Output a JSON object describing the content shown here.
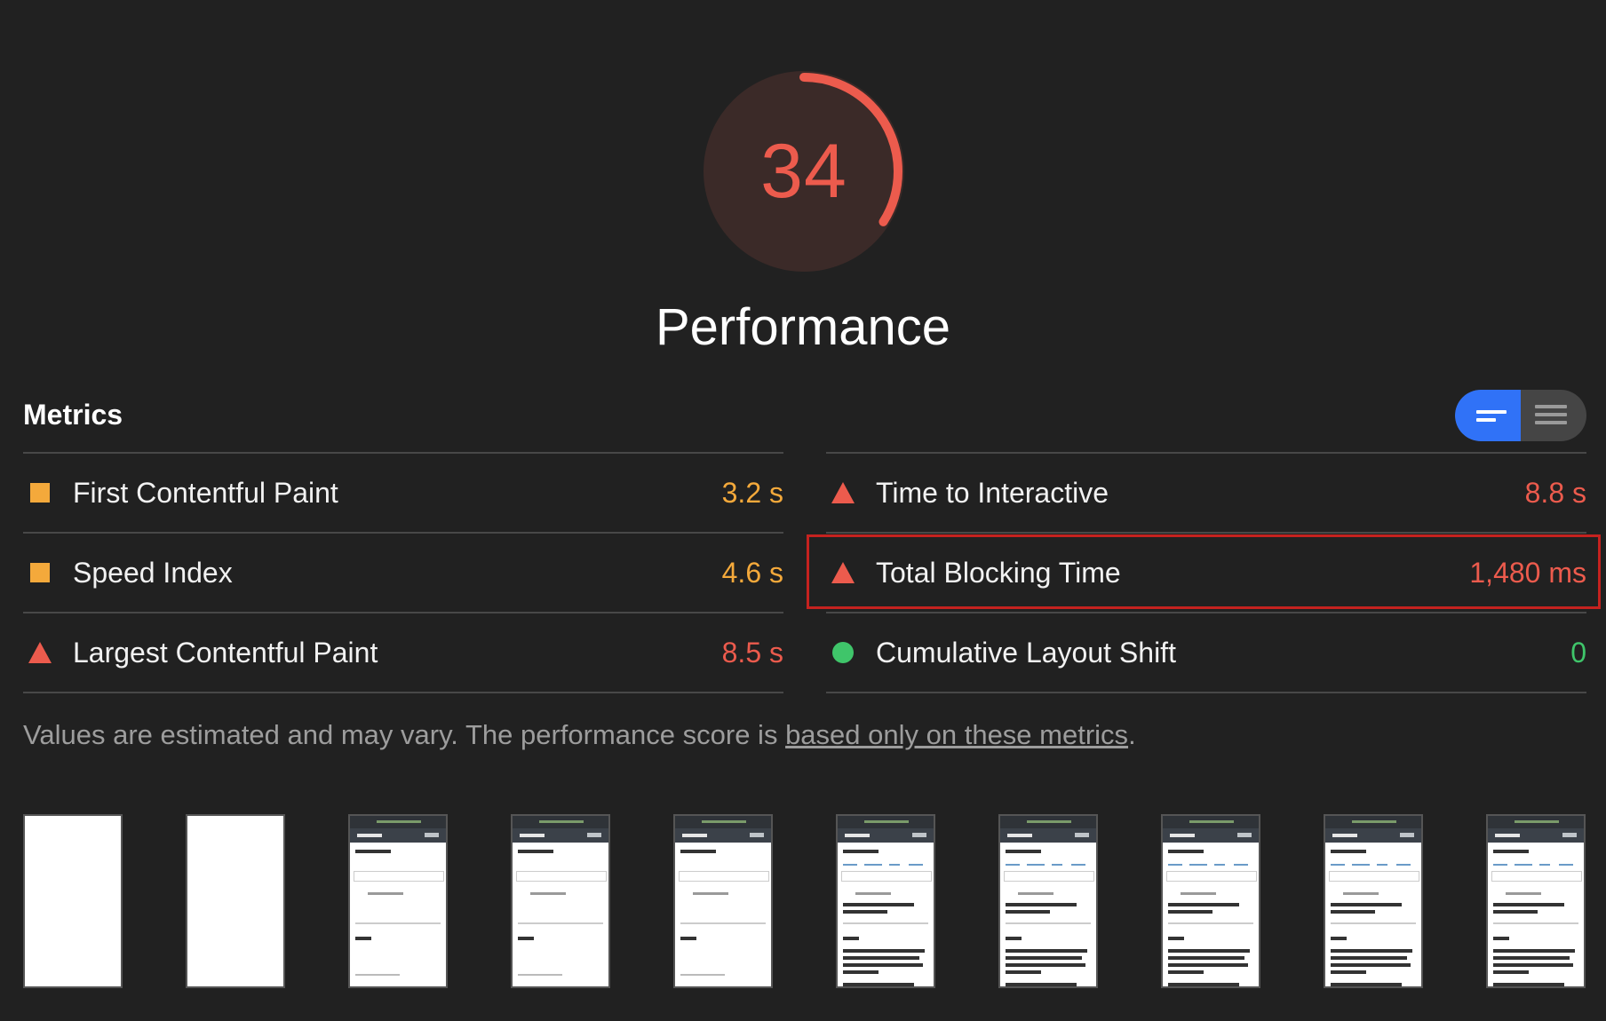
{
  "gauge": {
    "score": "34",
    "score_fraction": 0.34,
    "color": "#ec5b4d",
    "track_color": "#3b2a28"
  },
  "category_title": "Performance",
  "metrics": {
    "header": "Metrics",
    "left": [
      {
        "label": "First Contentful Paint",
        "value": "3.2 s",
        "rating": "average"
      },
      {
        "label": "Speed Index",
        "value": "4.6 s",
        "rating": "average"
      },
      {
        "label": "Largest Contentful Paint",
        "value": "8.5 s",
        "rating": "fail"
      }
    ],
    "right": [
      {
        "label": "Time to Interactive",
        "value": "8.8 s",
        "rating": "fail"
      },
      {
        "label": "Total Blocking Time",
        "value": "1,480 ms",
        "rating": "fail",
        "highlighted": true
      },
      {
        "label": "Cumulative Layout Shift",
        "value": "0",
        "rating": "pass"
      }
    ]
  },
  "view_toggle": {
    "active": "compact-view",
    "options": [
      "compact-view-icon",
      "expanded-view-icon"
    ],
    "active_color": "#3072f7"
  },
  "colors": {
    "average": "#f4a93b",
    "fail": "#ec5b4d",
    "pass": "#3fc56a",
    "highlight": "#c5221f"
  },
  "disclaimer": {
    "before": "Values are estimated and may vary. The performance score is ",
    "link": "based only on these metrics",
    "after": "."
  },
  "filmstrip": {
    "frame_count": 10,
    "blank_frames": 2
  }
}
